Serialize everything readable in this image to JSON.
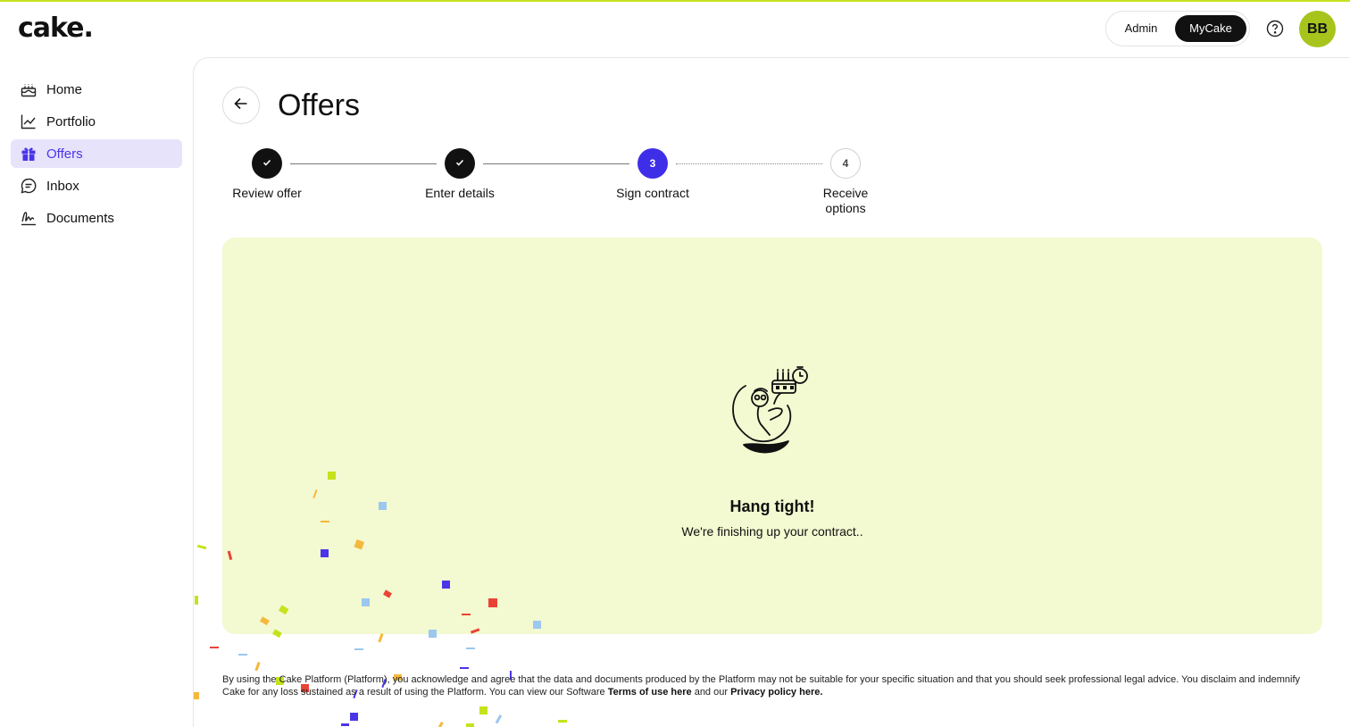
{
  "brand": {
    "logo_text": "cake.",
    "accent": "#c6e21c",
    "primary": "#3f2ee8"
  },
  "header": {
    "mode_switch": {
      "admin_label": "Admin",
      "mycake_label": "MyCake",
      "selected": "MyCake"
    },
    "help_icon": "question-circle-icon",
    "avatar_initials": "BB"
  },
  "sidebar": {
    "items": [
      {
        "label": "Home",
        "icon": "cake-icon",
        "active": false
      },
      {
        "label": "Portfolio",
        "icon": "chart-line-icon",
        "active": false
      },
      {
        "label": "Offers",
        "icon": "gift-icon",
        "active": true
      },
      {
        "label": "Inbox",
        "icon": "chat-bubble-icon",
        "active": false
      },
      {
        "label": "Documents",
        "icon": "signature-icon",
        "active": false
      }
    ]
  },
  "main": {
    "title": "Offers",
    "stepper": {
      "steps": [
        {
          "number": "1",
          "label": "Review offer",
          "state": "done"
        },
        {
          "number": "2",
          "label": "Enter details",
          "state": "done"
        },
        {
          "number": "3",
          "label": "Sign contract",
          "state": "current"
        },
        {
          "number": "4",
          "label": "Receive options",
          "state": "todo"
        }
      ]
    },
    "status": {
      "title": "Hang tight!",
      "subtitle": "We're finishing up your contract..",
      "illustration": "person-holding-cake-illustration"
    },
    "disclaimer": {
      "text_before": "By using the Cake Platform (Platform), you acknowledge and agree that the data and documents produced by the Platform may not be suitable for your specific situation and that you should seek professional legal advice. You disclaim and indemnify Cake for any loss sustained as a result of using the Platform. You can view our Software ",
      "terms_link": "Terms of use here",
      "text_middle": " and our ",
      "privacy_link": "Privacy policy here."
    }
  }
}
